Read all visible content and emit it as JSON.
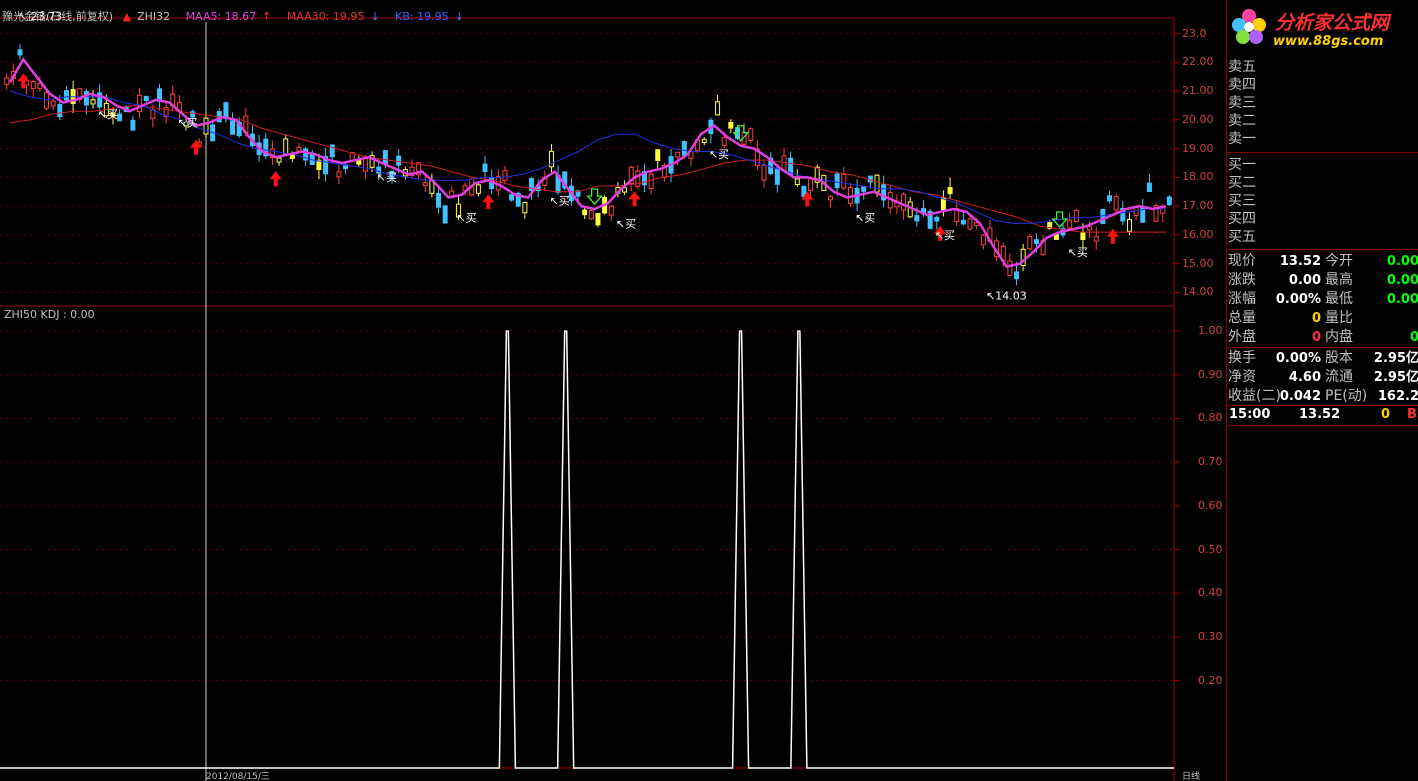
{
  "chart": {
    "title": "豫光金铅(日线,前复权)",
    "legend": [
      {
        "text": "ZHI32",
        "color": "#c0c0c0",
        "arrow": "up-red"
      },
      {
        "text": "MAA5: 18.67",
        "color": "#e040e0",
        "arrow": "up"
      },
      {
        "text": "MAA30: 19.95",
        "color": "#e03030",
        "arrow": "down"
      },
      {
        "text": "KB: 19.95",
        "color": "#4060ff",
        "arrow": "down"
      }
    ],
    "sub_legend": "ZHI50 KDJ : 0.00",
    "high_label": "23.73",
    "low_label": "14.03",
    "buy_label": "买",
    "price_axis": [
      "23.0",
      "22.00",
      "21.00",
      "20.00",
      "19.00",
      "18.00",
      "17.00",
      "16.00",
      "15.00",
      "14.00"
    ],
    "sub_axis": [
      "1.00",
      "0.90",
      "0.80",
      "0.70",
      "0.60",
      "0.50",
      "0.40",
      "0.30",
      "0.20"
    ],
    "bottom_date": "2012/08/15/三",
    "bottom_right": "日线"
  },
  "chart_data": {
    "type": "line",
    "price_range": [
      13.6,
      23.4
    ],
    "kdj_range": [
      0,
      1
    ],
    "ma5": [
      21.3,
      22.1,
      21.5,
      20.9,
      20.6,
      20.7,
      20.9,
      20.8,
      20.5,
      20.3,
      20.5,
      20.7,
      20.6,
      20.2,
      19.8,
      19.9,
      20.1,
      20.0,
      19.4,
      18.9,
      18.7,
      18.8,
      18.9,
      18.8,
      18.6,
      18.5,
      18.6,
      18.7,
      18.5,
      18.3,
      18.1,
      18.2,
      17.8,
      17.3,
      17.4,
      17.8,
      17.9,
      17.7,
      17.4,
      17.3,
      17.9,
      18.2,
      17.6,
      17.0,
      16.9,
      17.1,
      17.6,
      18.0,
      18.2,
      18.3,
      18.5,
      18.8,
      19.5,
      19.8,
      19.4,
      19.1,
      19.0,
      18.7,
      18.3,
      18.0,
      18.0,
      17.9,
      17.5,
      17.3,
      17.4,
      17.5,
      17.3,
      17.1,
      16.9,
      16.7,
      16.8,
      16.9,
      16.8,
      16.4,
      15.6,
      14.9,
      15.0,
      15.4,
      15.9,
      16.1,
      16.2,
      16.3,
      16.5,
      16.7,
      16.9,
      17.0,
      16.9,
      17.0
    ],
    "ma30": [
      19.9,
      20.0,
      20.2,
      20.3,
      20.3,
      20.4,
      20.5,
      20.4,
      20.3,
      20.2,
      20.1,
      20.0,
      19.7,
      19.5,
      19.3,
      19.1,
      18.9,
      18.7,
      18.6,
      18.5,
      18.4,
      18.2,
      18.0,
      17.9,
      17.7,
      17.6,
      17.5,
      17.5,
      17.7,
      17.7,
      17.8,
      18.0,
      18.1,
      18.3,
      18.5,
      18.6,
      18.6,
      18.5,
      18.4,
      18.2,
      18.1,
      17.9,
      17.7,
      17.5,
      17.4,
      17.2,
      17.0,
      16.8,
      16.6,
      16.3,
      16.2,
      16.1,
      16.1,
      16.1,
      16.1,
      16.1
    ],
    "kb": [
      21.0,
      20.8,
      20.7,
      20.8,
      20.8,
      20.8,
      20.6,
      20.5,
      20.2,
      20.0,
      19.7,
      19.5,
      19.2,
      19.0,
      18.9,
      18.8,
      18.6,
      18.5,
      18.4,
      18.3,
      18.1,
      18.0,
      17.9,
      17.9,
      17.9,
      18.0,
      18.0,
      18.1,
      18.3,
      18.6,
      18.9,
      19.3,
      19.5,
      19.5,
      19.2,
      19.0,
      18.9,
      18.9,
      18.8,
      18.6,
      18.4,
      18.2,
      18.0,
      17.9,
      17.8,
      17.7,
      17.6,
      17.6,
      17.5,
      17.3,
      17.1,
      16.8,
      16.5,
      16.4,
      16.4,
      16.5,
      16.6,
      16.6,
      16.7,
      16.8,
      16.9,
      16.9
    ],
    "kdj_spikes": [
      0.43,
      0.48,
      0.63,
      0.68
    ]
  },
  "orderbook": {
    "sell": [
      "卖五",
      "卖四",
      "卖三",
      "卖二",
      "卖一"
    ],
    "buy": [
      "买一",
      "买二",
      "买三",
      "买四",
      "买五"
    ]
  },
  "quote": [
    {
      "l1": "现价",
      "v1": "13.52",
      "c1": "#ffffff",
      "l2": "今开",
      "v2": "0.00",
      "c2": "#00ff00"
    },
    {
      "l1": "涨跌",
      "v1": "0.00",
      "c1": "#ffffff",
      "l2": "最高",
      "v2": "0.00",
      "c2": "#00ff00"
    },
    {
      "l1": "涨幅",
      "v1": "0.00%",
      "c1": "#ffffff",
      "l2": "最低",
      "v2": "0.00",
      "c2": "#00ff00"
    },
    {
      "l1": "总量",
      "v1": "0",
      "c1": "#ffd000",
      "l2": "量比",
      "v2": "",
      "c2": "#ffffff"
    },
    {
      "l1": "外盘",
      "v1": "0",
      "c1": "#ff3030",
      "l2": "内盘",
      "v2": "0",
      "c2": "#00ff00"
    },
    {
      "l1": "换手",
      "v1": "0.00%",
      "c1": "#ffffff",
      "l2": "股本",
      "v2": "2.95亿",
      "c2": "#ffffff"
    },
    {
      "l1": "净资",
      "v1": "4.60",
      "c1": "#ffffff",
      "l2": "流通",
      "v2": "2.95亿",
      "c2": "#ffffff"
    },
    {
      "l1": "收益(二)",
      "v1": "0.042",
      "c1": "#ffffff",
      "l2": "PE(动)",
      "v2": "162.2",
      "c2": "#ffffff"
    }
  ],
  "tick": {
    "time": "15:00",
    "price": "13.52",
    "vol": "0",
    "side": "B"
  },
  "logo": {
    "cn": "分析家公式网",
    "url": "www.88gs.com"
  }
}
